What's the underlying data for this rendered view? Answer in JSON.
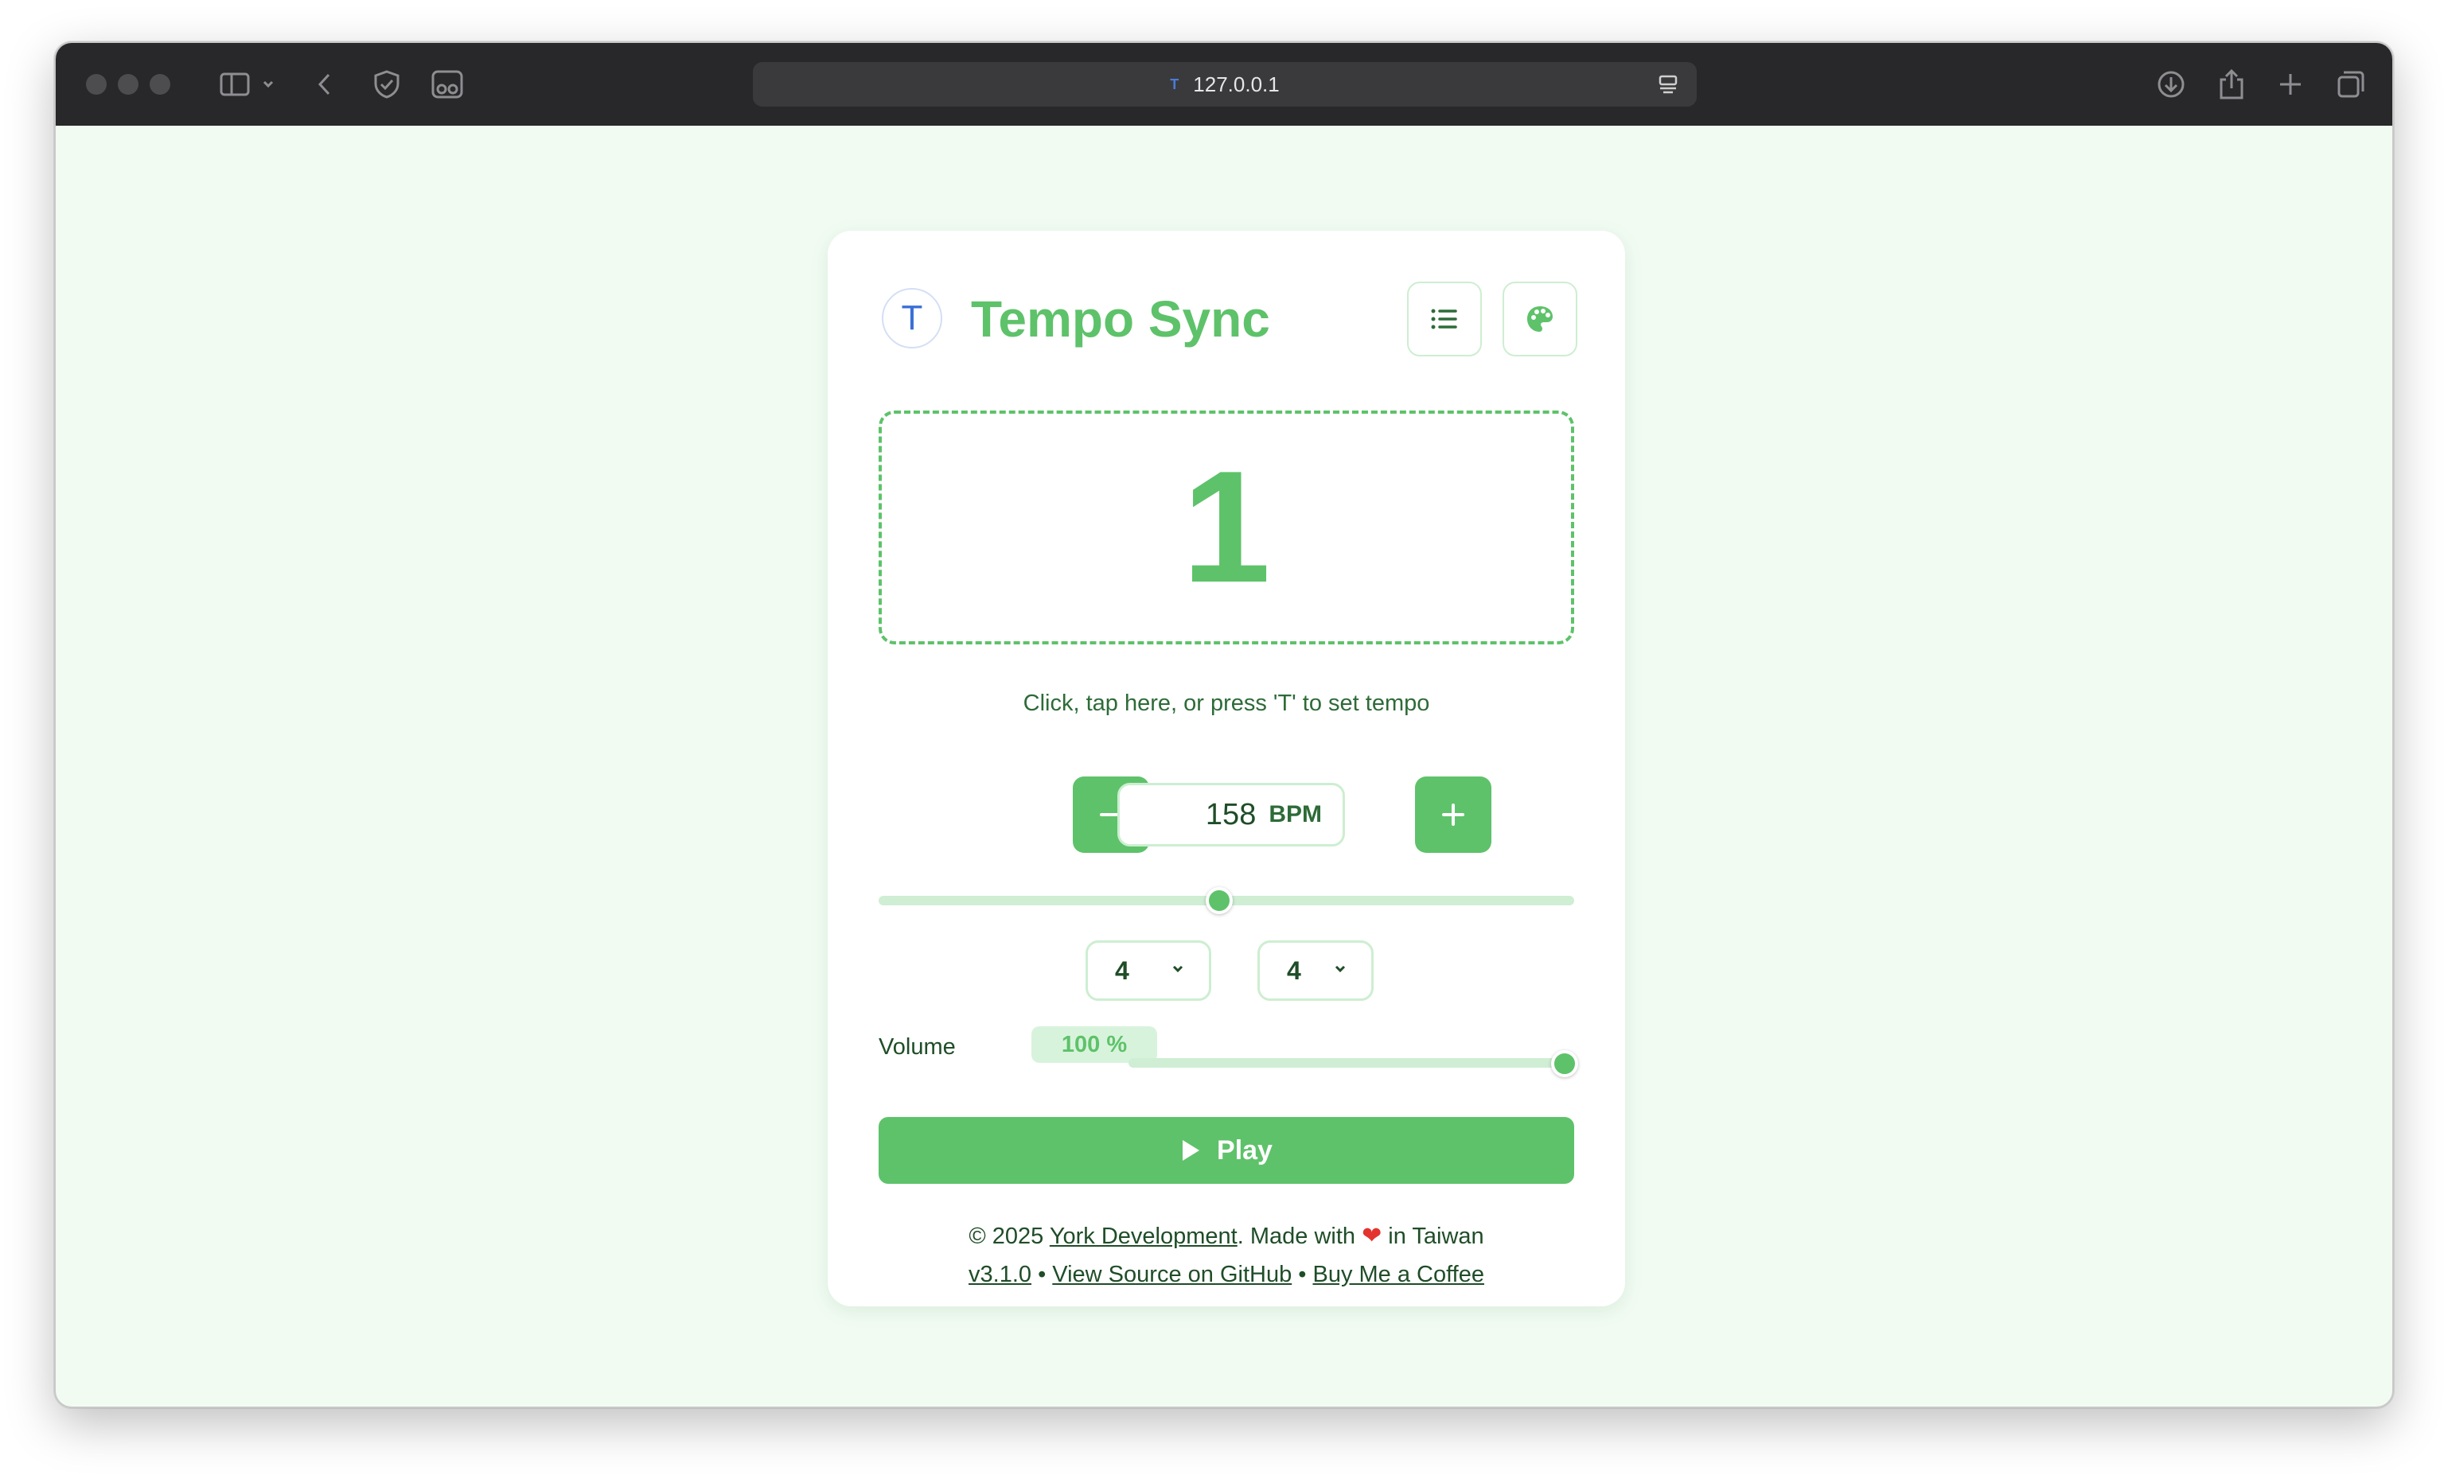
{
  "browser": {
    "url": "127.0.0.1",
    "favicon_letter": "T"
  },
  "app": {
    "logo_letter": "T",
    "title": "Tempo Sync",
    "beat_display": "1",
    "tap_hint": "Click, tap here, or press 'T' to set tempo",
    "decrement_label": "−",
    "increment_label": "+",
    "bpm_value": "158",
    "bpm_unit": "BPM",
    "tempo_slider_fraction": 0.49,
    "time_signature": {
      "beats": "4",
      "separator": "/",
      "note_value": "4"
    },
    "volume": {
      "label": "Volume",
      "value_text": "100 %",
      "fraction": 1.0
    },
    "play_label": "Play"
  },
  "footer": {
    "copyright_prefix": "© 2025 ",
    "company_link": "York Development",
    "made_with": ". Made with ",
    "heart": "❤",
    "location": " in Taiwan",
    "version_link": "v3.1.0",
    "bullet": " • ",
    "github_link": "View Source on GitHub",
    "coffee_link": "Buy Me a Coffee"
  },
  "colors": {
    "accent": "#5ec26a",
    "page_bg": "#f1fbf2",
    "text_dark": "#1f4d28"
  }
}
